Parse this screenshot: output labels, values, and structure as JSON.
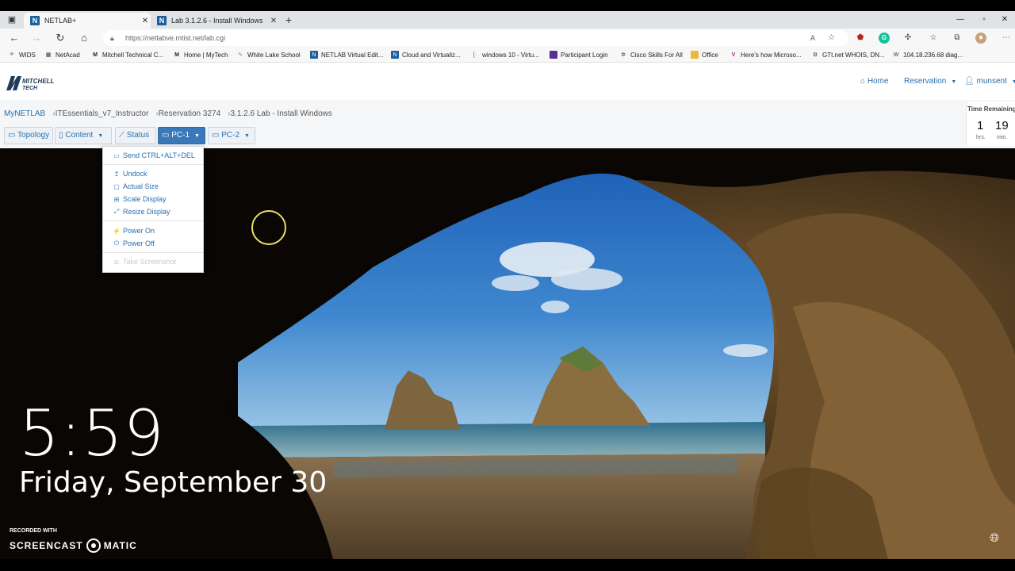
{
  "browser": {
    "tabs": [
      {
        "label": "NETLAB+",
        "favicon": "N"
      },
      {
        "label": "Lab 3.1.2.6 - Install Windows",
        "favicon": "N"
      }
    ],
    "url": "https://netlabve.mtist.net/lab.cgi",
    "bookmarks": [
      "WIDS",
      "NetAcad",
      "Mitchell Technical C...",
      "Home | MyTech",
      "White Lake School",
      "NETLAB Virtual Edit...",
      "Cloud and Virtualiz...",
      "windows 10 - Virtu...",
      "Participant Login",
      "Cisco Skills For All",
      "Office",
      "Here's how Microso...",
      "GTt.net WHOIS, DN...",
      "104.18.236.68 diag..."
    ]
  },
  "app": {
    "logo_line1": "MITCHELL",
    "logo_line2": "TECH",
    "nav": {
      "home": "Home",
      "reservation": "Reservation",
      "user": "munsent"
    },
    "breadcrumb": [
      "MyNETLAB",
      "ITEssentials_v7_Instructor",
      "Reservation 3274",
      "3.1.2.6 Lab - Install Windows"
    ],
    "toolbar": {
      "topology": "Topology",
      "content": "Content",
      "status": "Status",
      "pc1": "PC-1",
      "pc2": "PC-2"
    },
    "time": {
      "label": "Time Remaining",
      "hours": "1",
      "hours_unit": "hrs.",
      "minutes": "19",
      "minutes_unit": "min."
    },
    "menu": {
      "send_cad": "Send CTRL+ALT+DEL",
      "undock": "Undock",
      "actual_size": "Actual Size",
      "scale_display": "Scale Display",
      "resize_display": "Resize Display",
      "power_on": "Power On",
      "power_off": "Power Off",
      "take_screenshot": "Take Screenshot"
    }
  },
  "lockscreen": {
    "time": "5:59",
    "date": "Friday, September 30"
  },
  "watermark": {
    "line1": "RECORDED WITH",
    "line2a": "SCREENCAST",
    "line2b": "MATIC"
  },
  "colors": {
    "accent": "#2a6fae",
    "active_button": "#3a79b9"
  }
}
